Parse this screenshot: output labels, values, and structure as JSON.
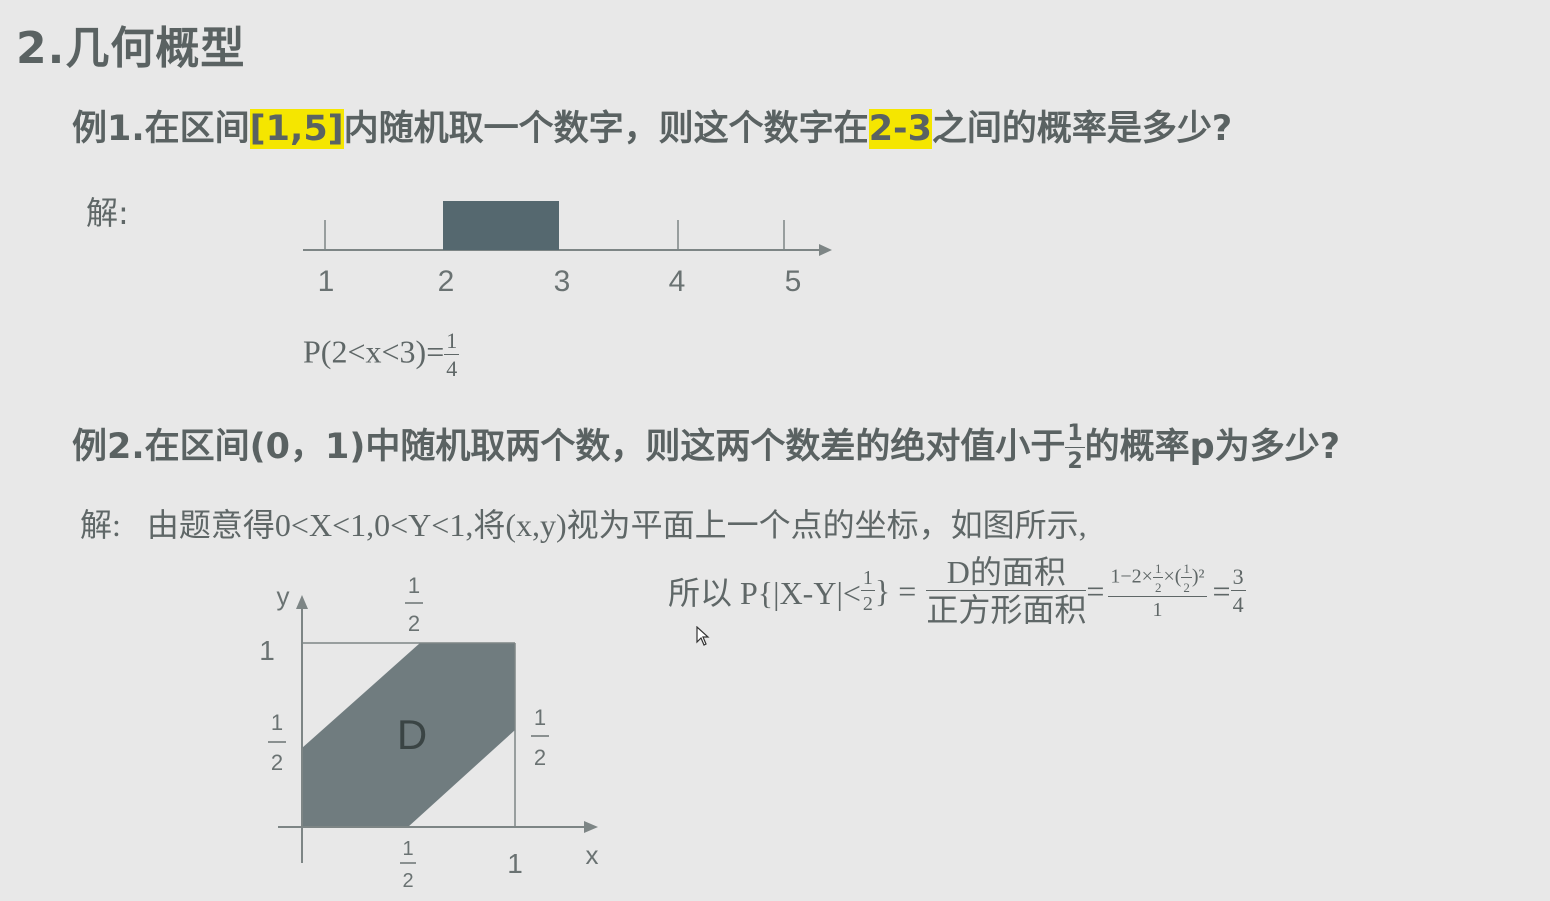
{
  "section_title": "2.几何概型",
  "example1": {
    "label": "例1.",
    "text_a": "在区间",
    "highlight_interval": "[1,5]",
    "text_b": "内随机取一个数字，则这个数字在",
    "highlight_range": "2-3",
    "text_c": "之间的概率是多少?",
    "solution_label": "解:",
    "axis_ticks": [
      "1",
      "2",
      "3",
      "4",
      "5"
    ],
    "shaded_interval": [
      2,
      3
    ],
    "result_prefix": "P(2<x<3)=",
    "result_num": "1",
    "result_den": "4"
  },
  "example2": {
    "label": "例2.",
    "text_a": "在区间(0，1)中随机取两个数，则这两个数差的绝对值小于",
    "bound_num": "1",
    "bound_den": "2",
    "text_b": "的概率p为多少?",
    "solution_label": "解:",
    "solution_text": "由题意得0<X<1,0<Y<1,将(x,y)视为平面上一个点的坐标，如图所示,",
    "formula": {
      "prefix": "所以 P{|X-Y|<",
      "half_num": "1",
      "half_den": "2",
      "close": "} =",
      "frac1_num": "D的面积",
      "frac1_den": "正方形面积",
      "eq": "=",
      "frac2_num_a": "1−2×",
      "frac2_num_b": "×(",
      "frac2_num_c": ")²",
      "frac2_den": "1",
      "eq2": "=",
      "result_num": "3",
      "result_den": "4"
    },
    "graph": {
      "x_label": "x",
      "y_label": "y",
      "one": "1",
      "half_num": "1",
      "half_den": "2",
      "region_label": "D",
      "shade_color": "#707c7f"
    }
  },
  "colors": {
    "background": "#e8e8e8",
    "highlight": "#f5e600",
    "bar_fill": "#55686f",
    "axis": "#7d8585"
  }
}
